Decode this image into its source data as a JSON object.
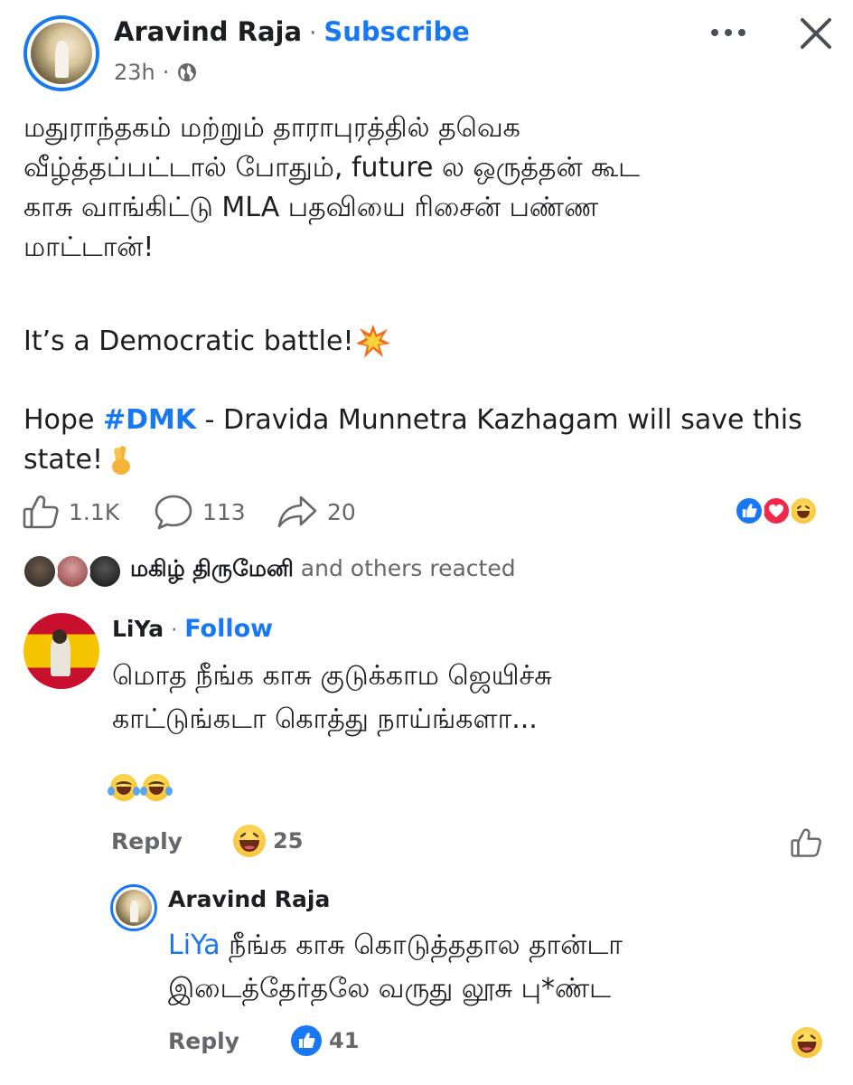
{
  "post": {
    "author": "Aravind Raja",
    "dot": "·",
    "subscribe_label": "Subscribe",
    "time": "23h",
    "time_dot": "·",
    "visibility_icon": "globe-icon",
    "text_lines": [
      "மதுராந்தகம் மற்றும் தாராபுரத்தில் தவெக",
      "வீழ்த்தப்பட்டால் போதும், future ல ஒருத்தன் கூட",
      "காசு வாங்கிட்டு MLA பதவியை ரிசைன் பண்ண",
      "மாட்டான்!"
    ],
    "battle_line": "It’s a Democratic battle!",
    "hope_prefix": "Hope ",
    "hashtag": "#DMK",
    "hope_rest": " - Dravida Munnetra Kazhagam will save this",
    "hope_line2": "state!"
  },
  "stats": {
    "likes": "1.1K",
    "comments": "113",
    "shares": "20",
    "reaction_icons": [
      "like-icon",
      "love-icon",
      "haha-icon"
    ]
  },
  "reacted": {
    "name": "மகிழ் திருமேனி",
    "rest": " and others reacted"
  },
  "comment1": {
    "author": "LiYa",
    "dot": "·",
    "follow_label": "Follow",
    "text_line1": "மொத நீங்க காசு குடுக்காம ஜெயிச்சு",
    "text_line2": "காட்டுங்கடா கொத்து நாய்ங்களா...",
    "reply_label": "Reply",
    "reaction_count": "25"
  },
  "reply1": {
    "author": "Aravind Raja",
    "mention": "LiYa",
    "text_line1": " நீங்க காசு கொடுத்ததால தான்டா",
    "text_line2": "இடைத்தேர்தலே வருது லூசு பு*ண்ட",
    "reply_label": "Reply",
    "reaction_count": "41"
  },
  "colors": {
    "accent": "#1877f2",
    "secondary_text": "#65676b",
    "primary_text": "#1c1e21"
  }
}
